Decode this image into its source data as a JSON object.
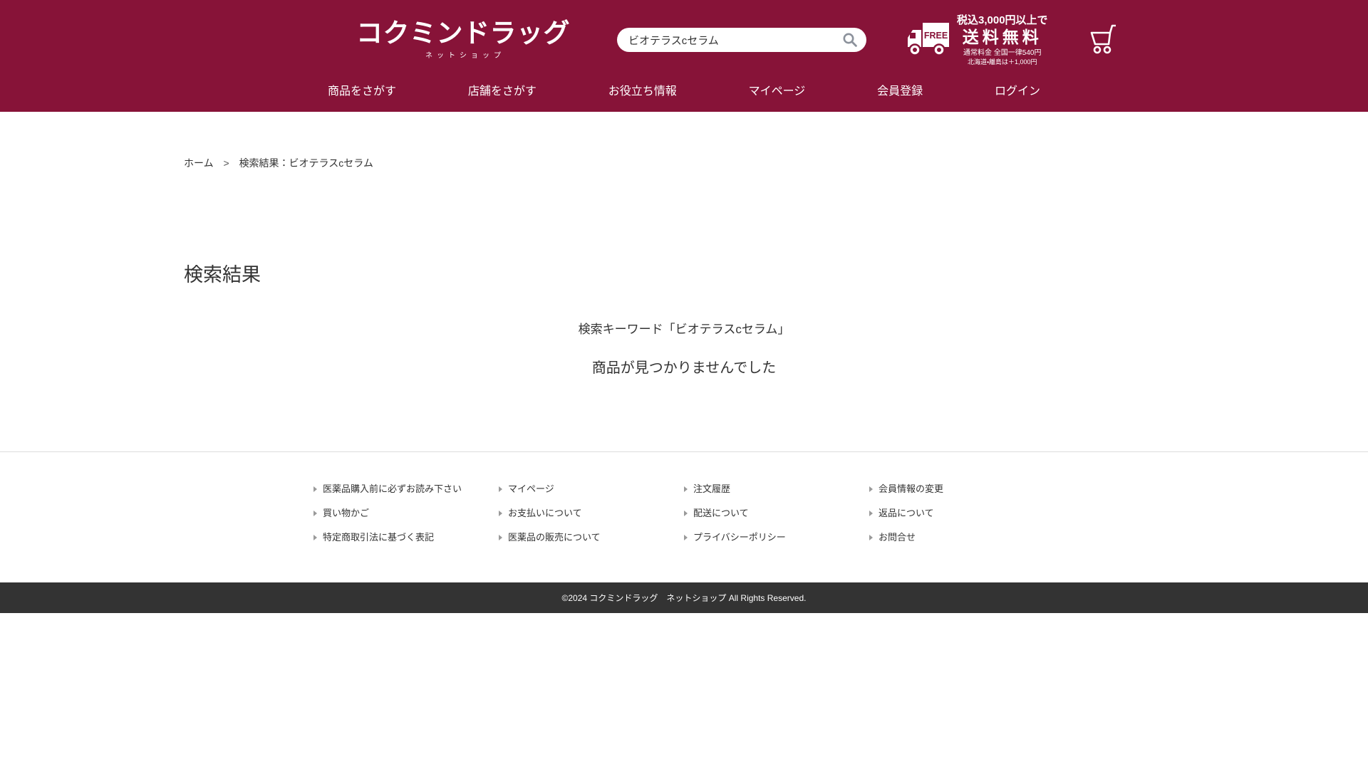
{
  "colors": {
    "brand": "#871338",
    "footer_bar": "#333333"
  },
  "brand": {
    "logo_text": "コクミンドラッグ",
    "logo_subtext": "ネットショップ"
  },
  "header": {
    "search": {
      "value": "ビオテラスcセラム"
    },
    "shipping": {
      "free_label": "FREE",
      "line1": "税込3,000円以上で",
      "line2": "送料無料",
      "line3": "通常料金 全国一律540円",
      "line4": "北海道・離島は＋1,000円"
    },
    "nav": [
      "商品をさがす",
      "店舗をさがす",
      "お役立ち情報",
      "マイページ",
      "会員登録",
      "ログイン"
    ]
  },
  "breadcrumb": {
    "home": "ホーム",
    "separator": ">",
    "current": "検索結果：ビオテラスcセラム"
  },
  "main": {
    "title": "検索結果",
    "keyword_line": "検索キーワード「ビオテラスcセラム」",
    "no_results": "商品が見つかりませんでした"
  },
  "footer": {
    "columns": [
      [
        "医薬品購入前に必ずお読み下さい",
        "買い物かご",
        "特定商取引法に基づく表記"
      ],
      [
        "マイページ",
        "お支払いについて",
        "医薬品の販売について"
      ],
      [
        "注文履歴",
        "配送について",
        "プライバシーポリシー"
      ],
      [
        "会員情報の変更",
        "返品について",
        "お問合せ"
      ]
    ],
    "copyright": "©2024 コクミンドラッグ　ネットショップ All Rights Reserved."
  }
}
